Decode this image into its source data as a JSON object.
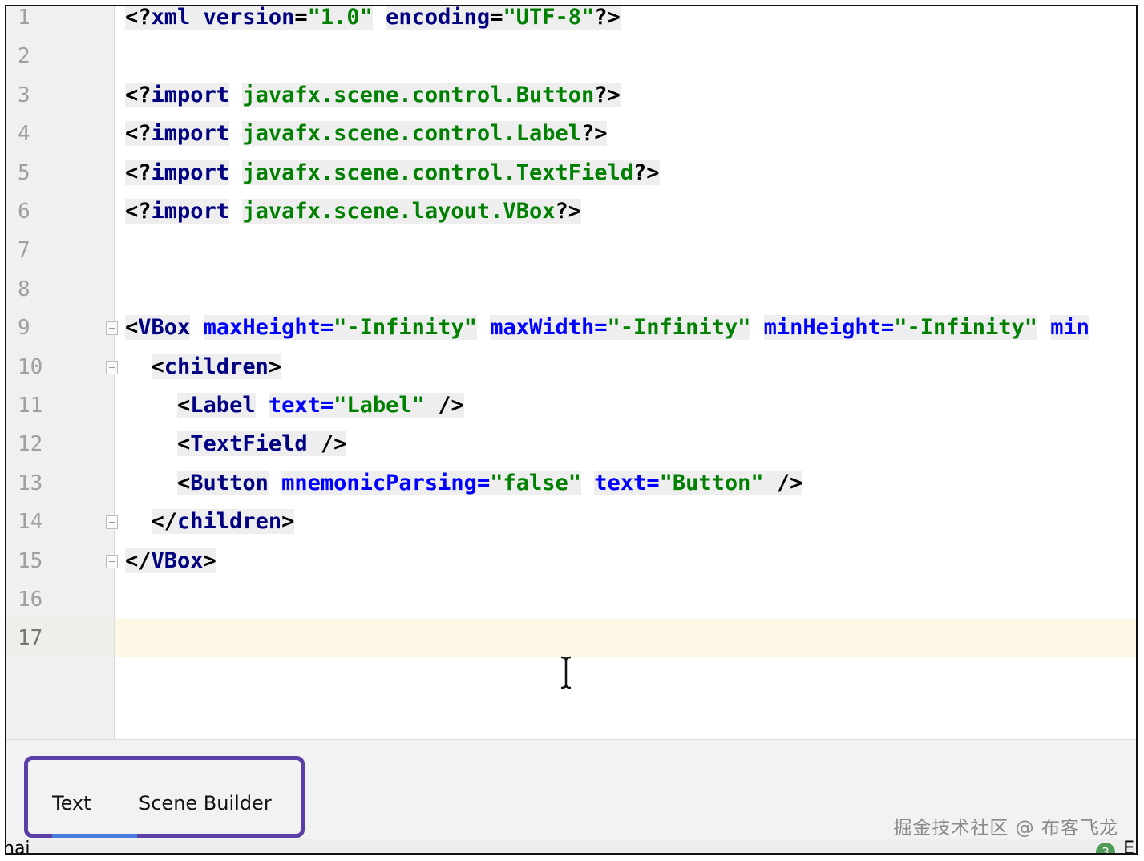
{
  "editor": {
    "lines": [
      {
        "num": "1",
        "segments": [
          {
            "t": "<?",
            "c": "pi"
          },
          {
            "t": "xml version",
            "c": "kw"
          },
          {
            "t": "=",
            "c": "pi"
          },
          {
            "t": "\"1.0\"",
            "c": "val"
          },
          {
            "t": " ",
            "c": "pi"
          },
          {
            "t": "encoding",
            "c": "kw"
          },
          {
            "t": "=",
            "c": "pi"
          },
          {
            "t": "\"UTF-8\"",
            "c": "val"
          },
          {
            "t": "?>",
            "c": "pi"
          }
        ]
      },
      {
        "num": "2",
        "segments": []
      },
      {
        "num": "3",
        "segments": [
          {
            "t": "<?",
            "c": "pi"
          },
          {
            "t": "import",
            "c": "kw"
          },
          {
            "t": " ",
            "c": "pi"
          },
          {
            "t": "javafx.scene.control.Button",
            "c": "pkg"
          },
          {
            "t": "?>",
            "c": "pi"
          }
        ]
      },
      {
        "num": "4",
        "segments": [
          {
            "t": "<?",
            "c": "pi"
          },
          {
            "t": "import",
            "c": "kw"
          },
          {
            "t": " ",
            "c": "pi"
          },
          {
            "t": "javafx.scene.control.Label",
            "c": "pkg"
          },
          {
            "t": "?>",
            "c": "pi"
          }
        ]
      },
      {
        "num": "5",
        "segments": [
          {
            "t": "<?",
            "c": "pi"
          },
          {
            "t": "import",
            "c": "kw"
          },
          {
            "t": " ",
            "c": "pi"
          },
          {
            "t": "javafx.scene.control.TextField",
            "c": "pkg"
          },
          {
            "t": "?>",
            "c": "pi"
          }
        ]
      },
      {
        "num": "6",
        "segments": [
          {
            "t": "<?",
            "c": "pi"
          },
          {
            "t": "import",
            "c": "kw"
          },
          {
            "t": " ",
            "c": "pi"
          },
          {
            "t": "javafx.scene.layout.VBox",
            "c": "pkg"
          },
          {
            "t": "?>",
            "c": "pi"
          }
        ]
      },
      {
        "num": "7",
        "segments": []
      },
      {
        "num": "8",
        "segments": []
      },
      {
        "num": "9",
        "segments": [
          {
            "t": "<",
            "c": "pi"
          },
          {
            "t": "VBox",
            "c": "tag"
          },
          {
            "t": " ",
            "c": "pi"
          },
          {
            "t": "maxHeight",
            "c": "attr"
          },
          {
            "t": "=",
            "c": "attr"
          },
          {
            "t": "\"-Infinity\"",
            "c": "val"
          },
          {
            "t": " ",
            "c": "pi"
          },
          {
            "t": "maxWidth",
            "c": "attr"
          },
          {
            "t": "=",
            "c": "attr"
          },
          {
            "t": "\"-Infinity\"",
            "c": "val"
          },
          {
            "t": " ",
            "c": "pi"
          },
          {
            "t": "minHeight",
            "c": "attr"
          },
          {
            "t": "=",
            "c": "attr"
          },
          {
            "t": "\"-Infinity\"",
            "c": "val"
          },
          {
            "t": " ",
            "c": "pi"
          },
          {
            "t": "min",
            "c": "attr"
          }
        ]
      },
      {
        "num": "10",
        "segments": [
          {
            "t": "  ",
            "c": "pi"
          },
          {
            "t": "<",
            "c": "pi"
          },
          {
            "t": "children",
            "c": "tag"
          },
          {
            "t": ">",
            "c": "pi"
          }
        ]
      },
      {
        "num": "11",
        "segments": [
          {
            "t": "    ",
            "c": "pi"
          },
          {
            "t": "<",
            "c": "pi"
          },
          {
            "t": "Label",
            "c": "tag"
          },
          {
            "t": " ",
            "c": "pi"
          },
          {
            "t": "text",
            "c": "attr"
          },
          {
            "t": "=",
            "c": "attr"
          },
          {
            "t": "\"Label\"",
            "c": "val"
          },
          {
            "t": " />",
            "c": "pi"
          }
        ]
      },
      {
        "num": "12",
        "segments": [
          {
            "t": "    ",
            "c": "pi"
          },
          {
            "t": "<",
            "c": "pi"
          },
          {
            "t": "TextField",
            "c": "tag"
          },
          {
            "t": " />",
            "c": "pi"
          }
        ]
      },
      {
        "num": "13",
        "segments": [
          {
            "t": "    ",
            "c": "pi"
          },
          {
            "t": "<",
            "c": "pi"
          },
          {
            "t": "Button",
            "c": "tag"
          },
          {
            "t": " ",
            "c": "pi"
          },
          {
            "t": "mnemonicParsing",
            "c": "attr"
          },
          {
            "t": "=",
            "c": "attr"
          },
          {
            "t": "\"false\"",
            "c": "val"
          },
          {
            "t": " ",
            "c": "pi"
          },
          {
            "t": "text",
            "c": "attr"
          },
          {
            "t": "=",
            "c": "attr"
          },
          {
            "t": "\"Button\"",
            "c": "val"
          },
          {
            "t": " />",
            "c": "pi"
          }
        ]
      },
      {
        "num": "14",
        "segments": [
          {
            "t": "  ",
            "c": "pi"
          },
          {
            "t": "</",
            "c": "pi"
          },
          {
            "t": "children",
            "c": "tag"
          },
          {
            "t": ">",
            "c": "pi"
          }
        ]
      },
      {
        "num": "15",
        "segments": [
          {
            "t": "</",
            "c": "pi"
          },
          {
            "t": "VBox",
            "c": "tag"
          },
          {
            "t": ">",
            "c": "pi"
          }
        ]
      },
      {
        "num": "16",
        "segments": []
      },
      {
        "num": "17",
        "segments": []
      }
    ],
    "current_line": "17"
  },
  "tabs": {
    "text_label": "Text",
    "scene_builder_label": "Scene Builder",
    "active": "Text"
  },
  "status": {
    "left_fragment": "hai",
    "badge_count": "3",
    "right_fragment": "E"
  },
  "watermark": "掘金技术社区 @ 布客飞龙",
  "colors": {
    "tag": "#000080",
    "attribute": "#0000ff",
    "value": "#008000",
    "tab_highlight_border": "#5b3fa6",
    "active_tab_underline": "#4a7be0",
    "current_line_bg": "#fdf8e6"
  }
}
